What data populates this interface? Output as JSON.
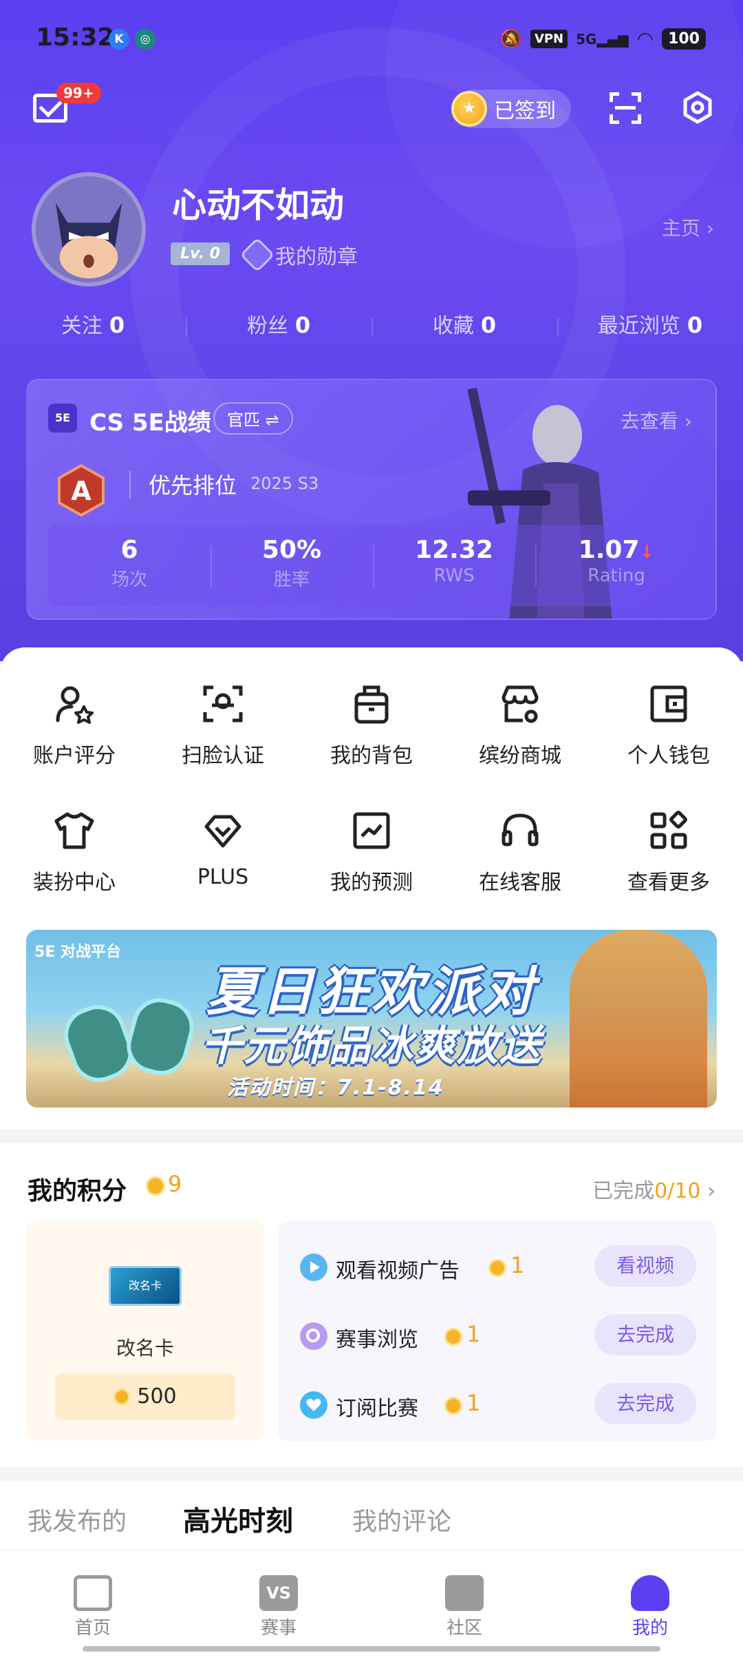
{
  "status": {
    "time": "15:32",
    "vpn": "VPN",
    "net": "5G",
    "battery": "100"
  },
  "header": {
    "mail_badge": "99+",
    "signed_label": "已签到"
  },
  "profile": {
    "name": "心动不如动",
    "level": "Lv. 0",
    "medal_label": "我的勋章",
    "homepage_label": "主页"
  },
  "stats": [
    {
      "label": "关注",
      "value": "0"
    },
    {
      "label": "粉丝",
      "value": "0"
    },
    {
      "label": "收藏",
      "value": "0"
    },
    {
      "label": "最近浏览",
      "value": "0"
    }
  ],
  "cs": {
    "logo": "5E",
    "title": "CS 5E战绩",
    "mode": "官匹 ⇌",
    "go_label": "去查看",
    "rank_name": "优先排位",
    "season": "2025 S3",
    "stats": [
      {
        "value": "6",
        "label": "场次"
      },
      {
        "value": "50%",
        "label": "胜率"
      },
      {
        "value": "12.32",
        "label": "RWS"
      },
      {
        "value": "1.07",
        "label": "Rating"
      }
    ]
  },
  "grid": [
    {
      "label": "账户评分",
      "icon": "user-star-icon"
    },
    {
      "label": "扫脸认证",
      "icon": "face-scan-icon"
    },
    {
      "label": "我的背包",
      "icon": "backpack-icon"
    },
    {
      "label": "缤纷商城",
      "icon": "store-icon"
    },
    {
      "label": "个人钱包",
      "icon": "wallet-icon"
    },
    {
      "label": "装扮中心",
      "icon": "tshirt-icon"
    },
    {
      "label": "PLUS",
      "icon": "diamond-icon"
    },
    {
      "label": "我的预测",
      "icon": "chart-icon"
    },
    {
      "label": "在线客服",
      "icon": "headset-icon"
    },
    {
      "label": "查看更多",
      "icon": "apps-icon"
    }
  ],
  "banner": {
    "platform": "5E 对战平台",
    "line1": "夏日狂欢派对",
    "line2": "千元饰品冰爽放送",
    "line3": "活动时间：7.1-8.14"
  },
  "points": {
    "title": "我的积分",
    "count": "9",
    "done_prefix": "已完成",
    "done_value": "0/10",
    "reward": {
      "name": "改名卡",
      "card_text": "改名卡",
      "price": "500"
    },
    "tasks": [
      {
        "name": "观看视频广告",
        "points": "1",
        "button": "看视频",
        "color": "#5ab6f0"
      },
      {
        "name": "赛事浏览",
        "points": "1",
        "button": "去完成",
        "color": "#b89af0"
      },
      {
        "name": "订阅比赛",
        "points": "1",
        "button": "去完成",
        "color": "#45b8f0"
      }
    ]
  },
  "tabs": [
    "我发布的",
    "高光时刻",
    "我的评论"
  ],
  "nav": [
    {
      "label": "首页",
      "icon": "home-icon"
    },
    {
      "label": "赛事",
      "icon": "vs-icon"
    },
    {
      "label": "社区",
      "icon": "chat-icon"
    },
    {
      "label": "我的",
      "icon": "profile-icon"
    }
  ],
  "colors": {
    "primary": "#5b3ff0",
    "accent": "#f0a21a",
    "badge": "#f23a3a"
  }
}
